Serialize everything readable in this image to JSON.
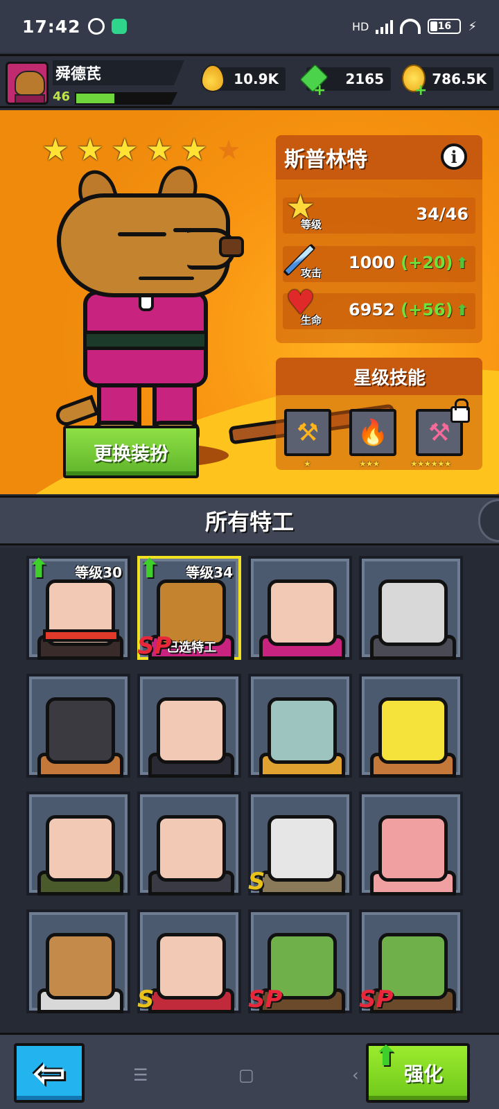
{
  "status_bar": {
    "time": "17:42",
    "network": "HD",
    "battery": "16"
  },
  "player": {
    "name": "舜德芪",
    "level": "46",
    "xp_fraction": 0.38
  },
  "currencies": [
    {
      "icon": "oil-drop-icon",
      "value": "10.9K"
    },
    {
      "icon": "green-gem-icon",
      "value": "2165"
    },
    {
      "icon": "gold-coin-icon",
      "value": "786.5K"
    }
  ],
  "hero": {
    "stars_filled": 5,
    "stars_total": 6,
    "name": "斯普林特",
    "outfit_button": "更换装扮",
    "stats": {
      "level": {
        "label": "等级",
        "value": "34/46"
      },
      "attack": {
        "label": "攻击",
        "value": "1000",
        "bonus": "(+20)"
      },
      "health": {
        "label": "生命",
        "value": "6952",
        "bonus": "(+56)"
      }
    },
    "star_skills": {
      "title": "星级技能",
      "skills": [
        {
          "icon": "axe-skill-icon",
          "stars": "★"
        },
        {
          "icon": "fire-skill-icon",
          "stars": "★★★"
        },
        {
          "icon": "hammer-skill-icon",
          "stars": "★★★★★★",
          "locked": true
        }
      ]
    }
  },
  "agents": {
    "title": "所有特工",
    "cards": [
      {
        "level": "等级30",
        "upgradable": true,
        "face": "#f2c9b5",
        "body": "#3a2b2b",
        "accent": "#e23a2a"
      },
      {
        "level": "等级34",
        "upgradable": true,
        "tag": "已选特工",
        "rank": "SP",
        "selected": true,
        "face": "#c4832f",
        "body": "#c8237e"
      },
      {
        "face": "#f2c9b5",
        "body": "#c8237e"
      },
      {
        "face": "#d8d8d8",
        "body": "#4a4a55"
      },
      {
        "face": "#3a3a40",
        "body": "#c4783a"
      },
      {
        "face": "#f2c9b5",
        "body": "#2a2a35"
      },
      {
        "face": "#9ec4bf",
        "body": "#e0a230"
      },
      {
        "face": "#f5e23a",
        "body": "#c4783a"
      },
      {
        "face": "#f2c9b5",
        "body": "#4a5a2a"
      },
      {
        "face": "#f2c9b5",
        "body": "#3a3a45"
      },
      {
        "rank": "S",
        "face": "#e6e6e6",
        "body": "#8a7a5a"
      },
      {
        "face": "#f0a0a0",
        "body": "#f0a0a0"
      },
      {
        "face": "#c48a4a",
        "body": "#d8d8d8"
      },
      {
        "rank": "S",
        "face": "#f2c9b5",
        "body": "#c02a3a"
      },
      {
        "rank": "SP",
        "face": "#6fb04a",
        "body": "#6a4a2a"
      },
      {
        "rank": "SP",
        "face": "#6fb04a",
        "body": "#6a4a2a"
      }
    ]
  },
  "bottom": {
    "back_icon": "back-arrow-icon",
    "upgrade_label": "强化"
  }
}
